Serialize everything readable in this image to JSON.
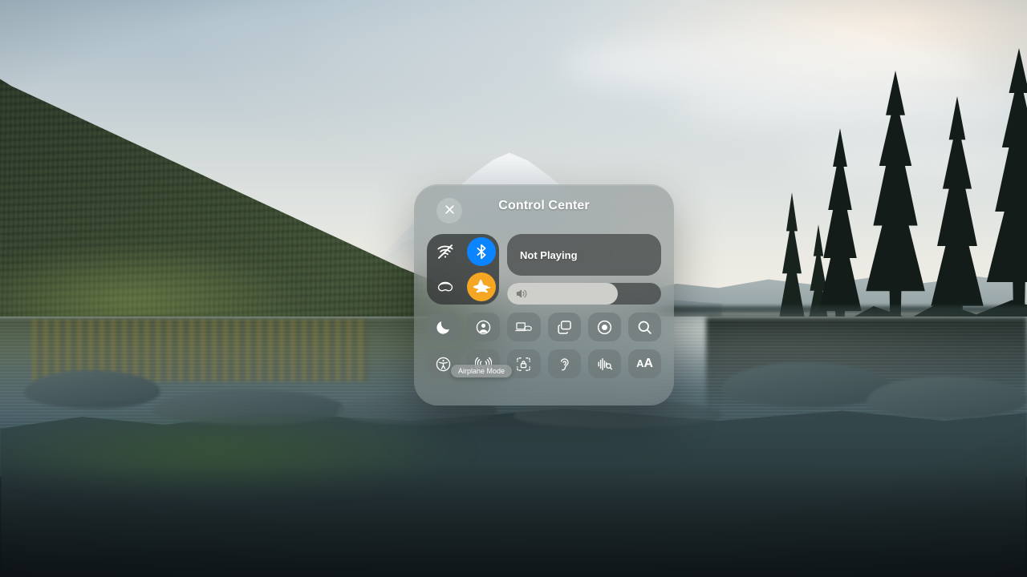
{
  "scene": {
    "description": "Lake with forested hillside, snow-capped mountain and pine trees at dusk"
  },
  "control_center": {
    "title": "Control Center",
    "close_icon": "close-icon",
    "connectivity": {
      "items": [
        {
          "name": "wifi",
          "icon": "wifi-slash-icon",
          "label": "Wi-Fi",
          "state": "off",
          "color": "transparent"
        },
        {
          "name": "bluetooth",
          "icon": "bluetooth-icon",
          "label": "Bluetooth",
          "state": "on",
          "color": "#0a84ff"
        },
        {
          "name": "vision-pro",
          "icon": "vision-pro-headset-icon",
          "label": "Vision Pro",
          "state": "off",
          "color": "transparent"
        },
        {
          "name": "airplane-mode",
          "icon": "airplane-icon",
          "label": "Airplane Mode",
          "state": "on",
          "color": "#f5a623"
        }
      ]
    },
    "now_playing": {
      "status": "Not Playing"
    },
    "volume": {
      "icon": "speaker-wave-icon",
      "level_percent": 72
    },
    "tooltip": {
      "text": "Airplane Mode"
    },
    "toggles_row1": [
      {
        "name": "focus",
        "icon": "moon-icon",
        "label": "Focus"
      },
      {
        "name": "persona",
        "icon": "person-circle-icon",
        "label": "Persona"
      },
      {
        "name": "mac-virtual-display",
        "icon": "mac-virtual-display-icon",
        "label": "Mac Virtual Display"
      },
      {
        "name": "window-manager",
        "icon": "windows-stack-icon",
        "label": "Windows"
      },
      {
        "name": "screen-record",
        "icon": "record-icon",
        "label": "Screen Recording"
      },
      {
        "name": "search",
        "icon": "search-icon",
        "label": "Search"
      }
    ],
    "toggles_row2": [
      {
        "name": "accessibility",
        "icon": "accessibility-icon",
        "label": "Accessibility"
      },
      {
        "name": "airplay",
        "icon": "airplay-broadcast-icon",
        "label": "AirPlay"
      },
      {
        "name": "screen-lock",
        "icon": "screen-lock-icon",
        "label": "Screen Lock"
      },
      {
        "name": "hearing",
        "icon": "ear-icon",
        "label": "Hearing"
      },
      {
        "name": "sound-recognition",
        "icon": "sound-recognition-icon",
        "label": "Sound Recognition"
      },
      {
        "name": "text-size",
        "icon": "text-size-icon",
        "label": "Text Size"
      }
    ]
  }
}
